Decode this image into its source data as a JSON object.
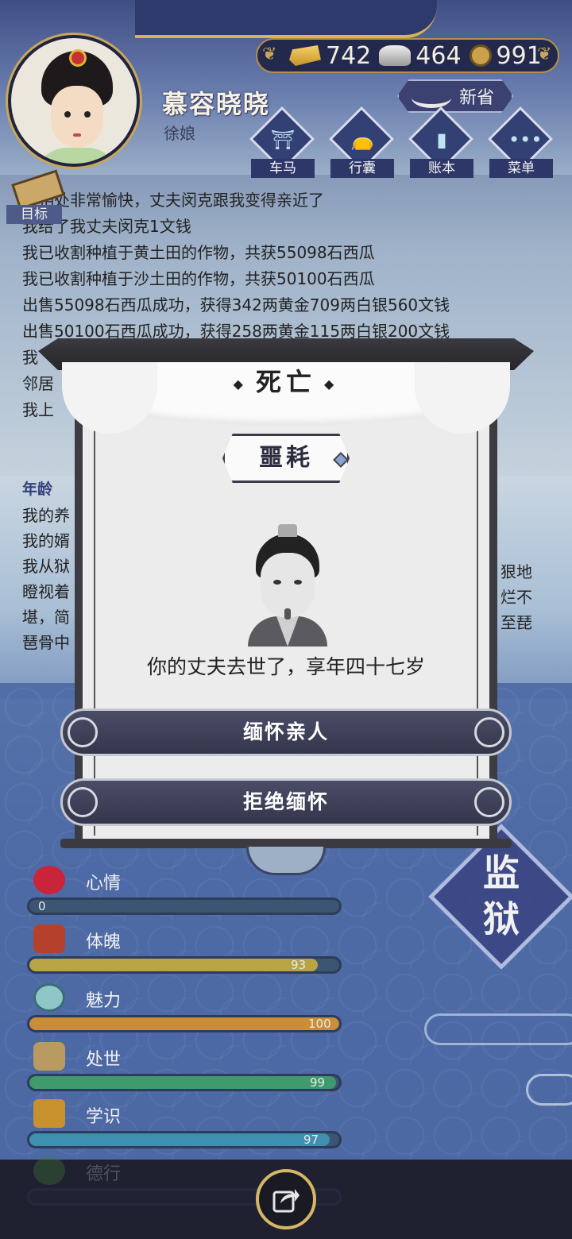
{
  "header": {
    "name": "慕容晓晓",
    "title": "徐娘"
  },
  "currency": {
    "gold": "742",
    "silver": "464",
    "coin": "991"
  },
  "news_button": {
    "label": "新省",
    "icon": "brush-icon"
  },
  "menu": [
    {
      "label": "车马",
      "icon": "carriage-icon"
    },
    {
      "label": "行囊",
      "icon": "bag-icon"
    },
    {
      "label": "账本",
      "icon": "ledger-icon"
    },
    {
      "label": "菜单",
      "icon": "more-icon"
    }
  ],
  "goal": {
    "label": "目标",
    "icon": "scroll-icon"
  },
  "log_top": [
    "相处非常愉快，丈夫闵克跟我变得亲近了",
    "我给了我丈夫闵克1文钱",
    "我已收割种植于黄土田的作物，共获55098石西瓜",
    "我已收割种植于沙土田的作物，共获50100石西瓜",
    "出售55098石西瓜成功，获得342两黄金709两白银560文钱",
    "出售50100石西瓜成功，获得258两黄金115两白银200文钱",
    "我",
    "邻居",
    "我上"
  ],
  "log_bottom": {
    "age": "年龄",
    "lines": [
      "我的养",
      "我的婿",
      "我从狱",
      "瞪视着",
      "堪，简",
      "琶骨中"
    ],
    "right_fragments": [
      "狠地",
      "烂不",
      "至琵"
    ]
  },
  "modal": {
    "title": "死亡",
    "subtitle": "噩耗",
    "message": "你的丈夫去世了，享年四十七岁",
    "primary_button": "缅怀亲人",
    "secondary_button": "拒绝缅怀"
  },
  "prison": {
    "label_1": "监",
    "label_2": "狱"
  },
  "stats": [
    {
      "label": "心情",
      "value": "0",
      "fraction": 0.0,
      "color": "#3b5573",
      "icon": "flower-icon"
    },
    {
      "label": "体魄",
      "value": "93",
      "fraction": 0.93,
      "color": "#b8a444",
      "icon": "vase-icon"
    },
    {
      "label": "魅力",
      "value": "100",
      "fraction": 1.0,
      "color": "#c98f38",
      "icon": "mirror-icon"
    },
    {
      "label": "处世",
      "value": "99",
      "fraction": 0.99,
      "color": "#3f9a6e",
      "icon": "tea-icon"
    },
    {
      "label": "学识",
      "value": "97",
      "fraction": 0.97,
      "color": "#3f8fb0",
      "icon": "books-icon"
    },
    {
      "label": "德行",
      "value": "",
      "fraction": 0.0,
      "color": "#6b3f8a",
      "icon": "jade-icon"
    }
  ],
  "bottom_bar": {
    "share_icon": "share-icon"
  }
}
